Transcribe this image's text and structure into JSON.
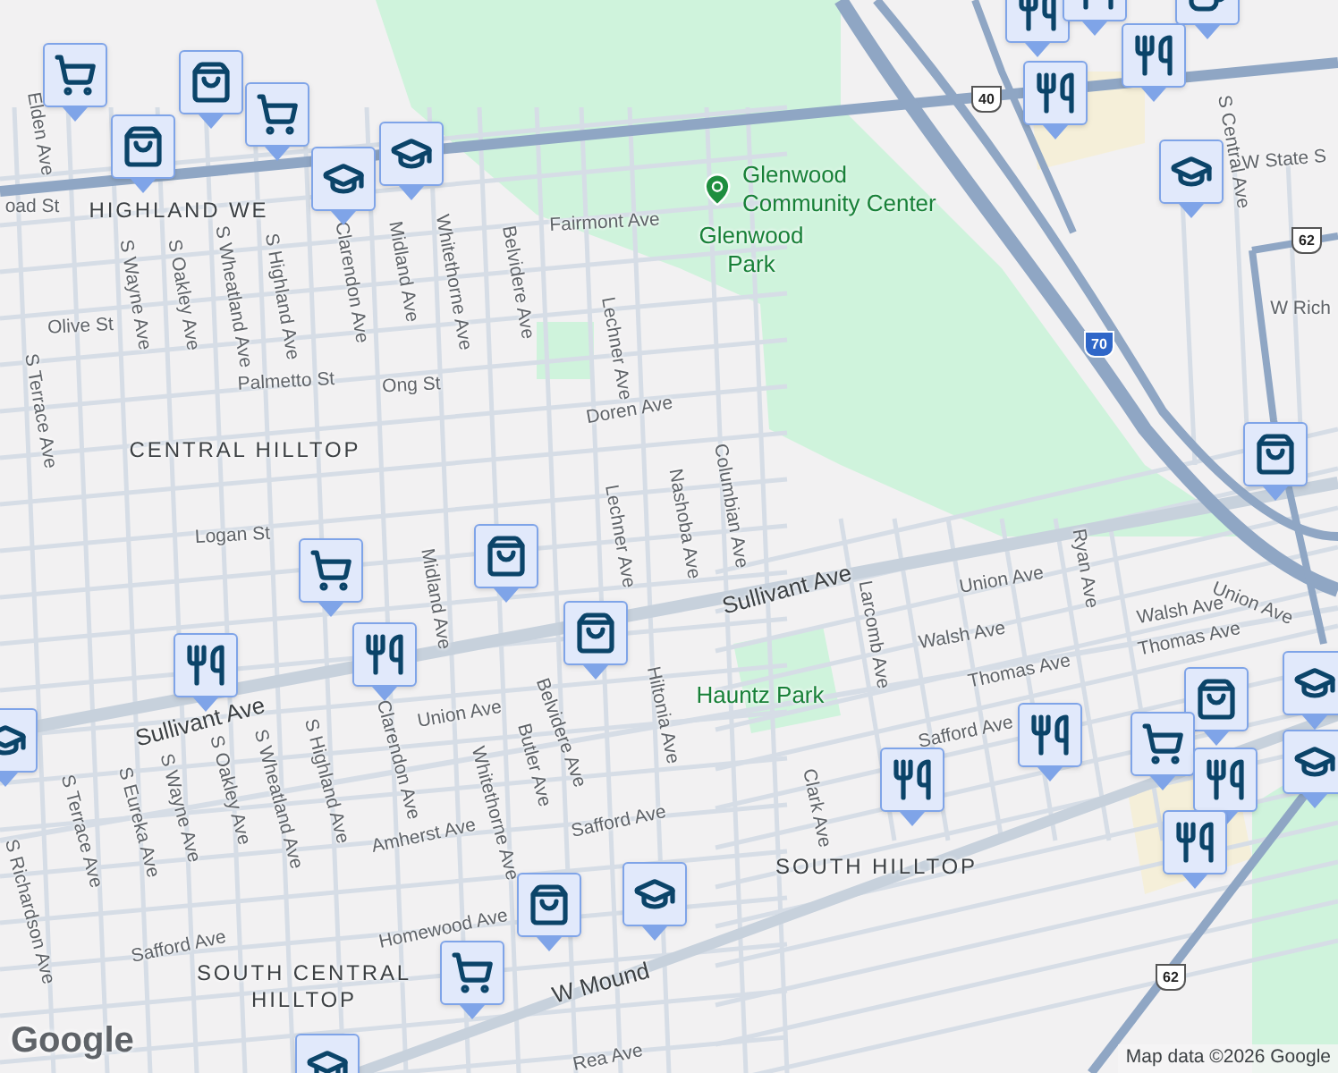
{
  "labels": [
    {
      "text": "Elden Ave",
      "kind": "street"
    },
    {
      "text": "oad St",
      "kind": "street"
    },
    {
      "text": "HIGHLAND WE",
      "kind": "area"
    },
    {
      "text": "S Wayne Ave",
      "kind": "street"
    },
    {
      "text": "S Oakley Ave",
      "kind": "street"
    },
    {
      "text": "S Wheatland Ave",
      "kind": "street"
    },
    {
      "text": "S Highland Ave",
      "kind": "street"
    },
    {
      "text": "Clarendon Ave",
      "kind": "street"
    },
    {
      "text": "Midland Ave",
      "kind": "street"
    },
    {
      "text": "Whitethorne Ave",
      "kind": "street"
    },
    {
      "text": "Belvidere Ave",
      "kind": "street"
    },
    {
      "text": "Fairmont Ave",
      "kind": "street"
    },
    {
      "text": "Lechner Ave",
      "kind": "street"
    },
    {
      "text": "Olive St",
      "kind": "street"
    },
    {
      "text": "Palmetto St",
      "kind": "street"
    },
    {
      "text": "Ong St",
      "kind": "street"
    },
    {
      "text": "Doren Ave",
      "kind": "street"
    },
    {
      "text": "CENTRAL HILLTOP",
      "kind": "area"
    },
    {
      "text": "S Terrace Ave",
      "kind": "street"
    },
    {
      "text": "Nashoba Ave",
      "kind": "street"
    },
    {
      "text": "Columbian Ave",
      "kind": "street"
    },
    {
      "text": "Logan St",
      "kind": "street"
    },
    {
      "text": "Midland Ave",
      "kind": "street"
    },
    {
      "text": "Lechner Ave",
      "kind": "street"
    },
    {
      "text": "Sullivant Ave",
      "kind": "major"
    },
    {
      "text": "Sullivant Ave",
      "kind": "major"
    },
    {
      "text": "Union Ave",
      "kind": "street"
    },
    {
      "text": "Union Ave",
      "kind": "street"
    },
    {
      "text": "Union Ave",
      "kind": "street"
    },
    {
      "text": "Walsh Ave",
      "kind": "street"
    },
    {
      "text": "Walsh Ave",
      "kind": "street"
    },
    {
      "text": "Thomas Ave",
      "kind": "street"
    },
    {
      "text": "Thomas Ave",
      "kind": "street"
    },
    {
      "text": "Safford Ave",
      "kind": "street"
    },
    {
      "text": "Safford Ave",
      "kind": "street"
    },
    {
      "text": "Safford Ave",
      "kind": "street"
    },
    {
      "text": "Amherst Ave",
      "kind": "street"
    },
    {
      "text": "Homewood Ave",
      "kind": "street"
    },
    {
      "text": "W Mound",
      "kind": "major"
    },
    {
      "text": "Hiltonia Ave",
      "kind": "street"
    },
    {
      "text": "Larcomb Ave",
      "kind": "street"
    },
    {
      "text": "Ryan Ave",
      "kind": "street"
    },
    {
      "text": "Clark Ave",
      "kind": "street"
    },
    {
      "text": "Belvidere Ave",
      "kind": "street"
    },
    {
      "text": "Butler Ave",
      "kind": "street"
    },
    {
      "text": "Whitethorne Ave",
      "kind": "street"
    },
    {
      "text": "Clarendon Ave",
      "kind": "street"
    },
    {
      "text": "S Highland Ave",
      "kind": "street"
    },
    {
      "text": "S Wheatland Ave",
      "kind": "street"
    },
    {
      "text": "S Oakley Ave",
      "kind": "street"
    },
    {
      "text": "S Wayne Ave",
      "kind": "street"
    },
    {
      "text": "S Eureka Ave",
      "kind": "street"
    },
    {
      "text": "S Terrace Ave",
      "kind": "street"
    },
    {
      "text": "S Richardson Ave",
      "kind": "street"
    },
    {
      "text": "SOUTH HILLTOP",
      "kind": "area"
    },
    {
      "text": "SOUTH CENTRAL\nHILLTOP",
      "kind": "area"
    },
    {
      "text": "Hauntz Park",
      "kind": "park"
    },
    {
      "text": "Glenwood\nPark",
      "kind": "park"
    },
    {
      "text": "W State S",
      "kind": "street"
    },
    {
      "text": "S Central Ave",
      "kind": "street"
    },
    {
      "text": "W Rich",
      "kind": "street"
    },
    {
      "text": "Rea Ave",
      "kind": "street"
    }
  ],
  "place": {
    "text": "Glenwood\nCommunity Center"
  },
  "shields": [
    {
      "text": "40",
      "kind": "us"
    },
    {
      "text": "62",
      "kind": "us"
    },
    {
      "text": "70",
      "kind": "interstate"
    },
    {
      "text": "62",
      "kind": "us"
    }
  ],
  "pins": [
    {
      "kind": "grocery"
    },
    {
      "kind": "shopping"
    },
    {
      "kind": "shopping"
    },
    {
      "kind": "grocery"
    },
    {
      "kind": "school"
    },
    {
      "kind": "school"
    },
    {
      "kind": "restaurant"
    },
    {
      "kind": "restaurant"
    },
    {
      "kind": "cafe"
    },
    {
      "kind": "restaurant"
    },
    {
      "kind": "restaurant"
    },
    {
      "kind": "school"
    },
    {
      "kind": "shopping"
    },
    {
      "kind": "shopping"
    },
    {
      "kind": "grocery"
    },
    {
      "kind": "restaurant"
    },
    {
      "kind": "restaurant"
    },
    {
      "kind": "shopping"
    },
    {
      "kind": "school"
    },
    {
      "kind": "restaurant"
    },
    {
      "kind": "restaurant"
    },
    {
      "kind": "shopping"
    },
    {
      "kind": "grocery"
    },
    {
      "kind": "restaurant"
    },
    {
      "kind": "restaurant"
    },
    {
      "kind": "school"
    },
    {
      "kind": "school"
    },
    {
      "kind": "shopping"
    },
    {
      "kind": "school"
    },
    {
      "kind": "grocery"
    },
    {
      "kind": "school"
    }
  ],
  "attribution": "Map data ©2026 Google",
  "logo": "Google"
}
